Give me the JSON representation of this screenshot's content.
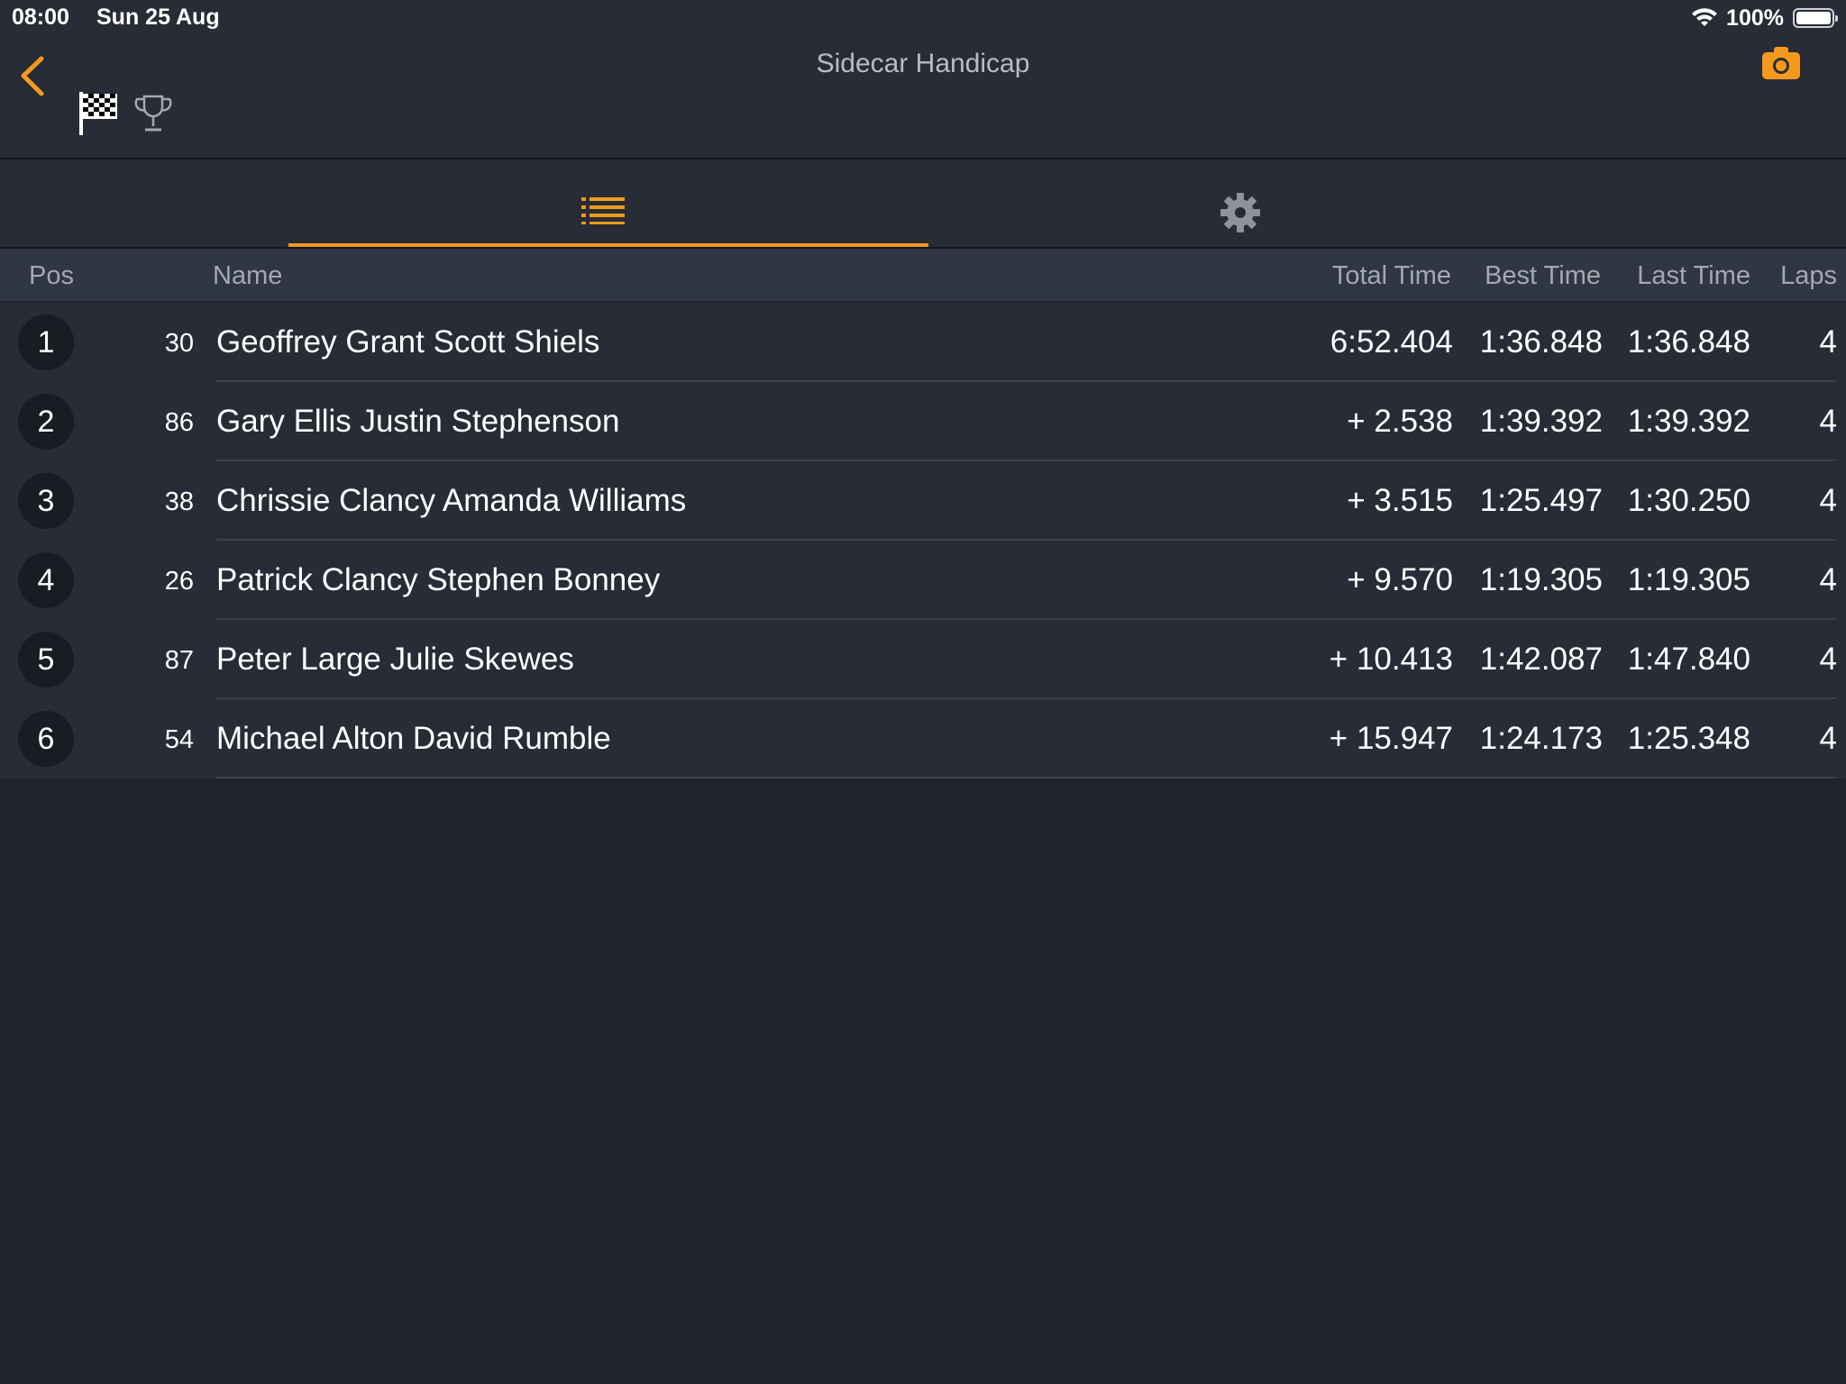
{
  "status_bar": {
    "time": "08:00",
    "date": "Sun 25 Aug",
    "battery": "100%",
    "icons": [
      "wifi-icon",
      "battery-icon"
    ]
  },
  "header": {
    "title": "Sidecar Handicap",
    "back_icon": "chevron-left-icon",
    "camera_icon": "camera-icon",
    "flag_icon": "checkered-flag-icon",
    "trophy_icon": "trophy-icon"
  },
  "tabs": [
    {
      "icon": "list-icon",
      "active": true
    },
    {
      "icon": "gear-icon",
      "active": false
    }
  ],
  "columns": {
    "pos": "Pos",
    "name": "Name",
    "total_time": "Total Time",
    "best_time": "Best Time",
    "last_time": "Last Time",
    "laps": "Laps"
  },
  "results": [
    {
      "pos": "1",
      "number": "30",
      "name": "Geoffrey Grant Scott Shiels",
      "total": "6:52.404",
      "best": "1:36.848",
      "last": "1:36.848",
      "laps": "4"
    },
    {
      "pos": "2",
      "number": "86",
      "name": "Gary Ellis Justin Stephenson",
      "total": "+ 2.538",
      "best": "1:39.392",
      "last": "1:39.392",
      "laps": "4"
    },
    {
      "pos": "3",
      "number": "38",
      "name": "Chrissie Clancy Amanda Williams",
      "total": "+ 3.515",
      "best": "1:25.497",
      "last": "1:30.250",
      "laps": "4"
    },
    {
      "pos": "4",
      "number": "26",
      "name": "Patrick Clancy Stephen Bonney",
      "total": "+ 9.570",
      "best": "1:19.305",
      "last": "1:19.305",
      "laps": "4"
    },
    {
      "pos": "5",
      "number": "87",
      "name": "Peter Large Julie Skewes",
      "total": "+ 10.413",
      "best": "1:42.087",
      "last": "1:47.840",
      "laps": "4"
    },
    {
      "pos": "6",
      "number": "54",
      "name": "Michael Alton David Rumble",
      "total": "+ 15.947",
      "best": "1:24.173",
      "last": "1:25.348",
      "laps": "4"
    }
  ],
  "colors": {
    "accent": "#f39a1e",
    "background": "#1f232c",
    "panel": "#272c36"
  }
}
